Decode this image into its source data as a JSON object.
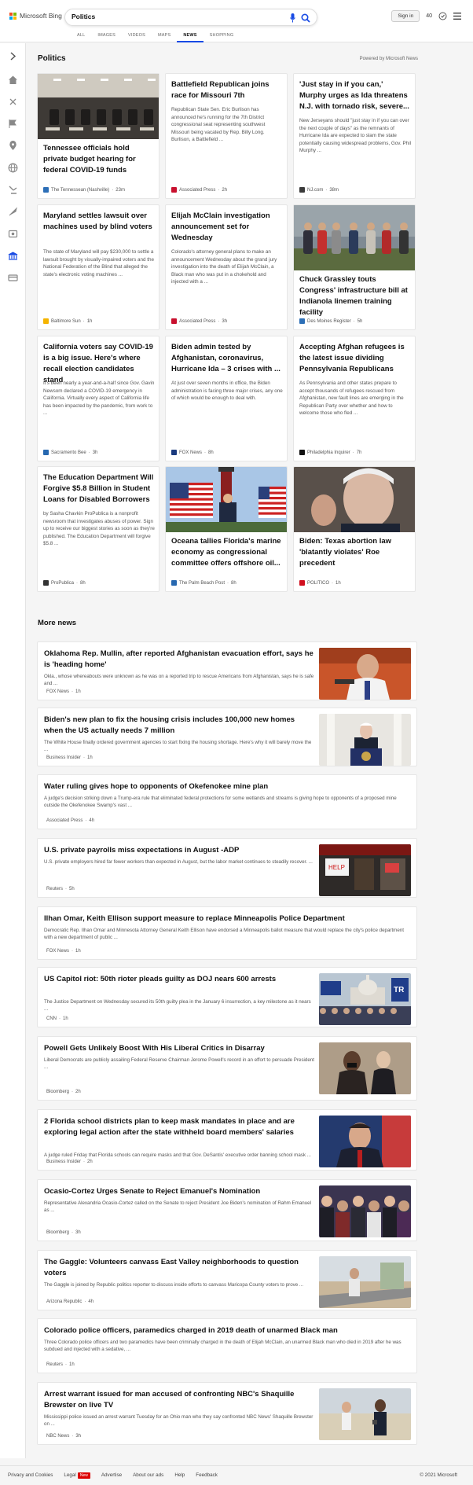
{
  "header": {
    "brand": "Microsoft Bing",
    "search_value": "Politics",
    "signin": "Sign in",
    "points": "40"
  },
  "nav": [
    "ALL",
    "IMAGES",
    "VIDEOS",
    "MAPS",
    "NEWS",
    "SHOPPING"
  ],
  "section_title": "Politics",
  "powered_by": "Powered by Microsoft News",
  "cards": [
    {
      "title": "Tennessee officials hold private budget hearing for federal COVID-19 funds",
      "snippet": "",
      "source": "The Tennessean (Nashville)",
      "age": "23m",
      "image": "meeting-room"
    },
    {
      "title": "Battlefield Republican joins race for Missouri 7th",
      "snippet": "Republican State Sen. Eric Burlison has announced he's running for the 7th District congressional seat representing southwest Missouri being vacated by Rep. Billy Long. Burlison, a Battlefield ...",
      "source": "Associated Press",
      "age": "2h",
      "image": ""
    },
    {
      "title": "'Just stay in if you can,' Murphy urges as Ida threatens N.J. with tornado risk, severe...",
      "snippet": "New Jerseyans should \"just stay in if you can over the next couple of days\" as the remnants of Hurricane Ida are expected to slam the state potentially causing widespread problems, Gov. Phil Murphy ...",
      "source": "NJ.com",
      "age": "38m",
      "image": ""
    },
    {
      "title": "Maryland settles lawsuit over machines used by blind voters",
      "snippet": "The state of Maryland will pay $230,000 to settle a lawsuit brought by visually-impaired voters and the National Federation of the Blind that alleged the state's electronic voting machines ...",
      "source": "Baltimore Sun",
      "age": "1h",
      "image": ""
    },
    {
      "title": "Elijah McClain investigation announcement set for Wednesday",
      "snippet": "Colorado's attorney general plans to make an announcement Wednesday about the grand jury investigation into the death of Elijah McClain, a Black man who was put in a chokehold and injected with a ...",
      "source": "Associated Press",
      "age": "3h",
      "image": ""
    },
    {
      "title": "Chuck Grassley touts Congress' infrastructure bill at Indianola linemen training facility",
      "snippet": "",
      "source": "Des Moines Register",
      "age": "5h",
      "image": "crowd-outdoors"
    },
    {
      "title": "California voters say COVID-19 is a big issue. Here's where recall election candidates stand",
      "snippet": "It's been nearly a year-and-a-half since Gov. Gavin Newsom declared a COVID-19 emergency in California. Virtually every aspect of California life has been impacted by the pandemic, from work to ...",
      "source": "Sacramento Bee",
      "age": "3h",
      "image": ""
    },
    {
      "title": "Biden admin tested by Afghanistan, coronavirus, Hurricane Ida – 3 crises with ...",
      "snippet": "At just over seven months in office, the Biden administration is facing three major crises, any one of which would be enough to deal with.",
      "source": "FOX News",
      "age": "8h",
      "image": ""
    },
    {
      "title": "Accepting Afghan refugees is the latest issue dividing Pennsylvania Republicans",
      "snippet": "As Pennsylvania and other states prepare to accept thousands of refugees rescued from Afghanistan, new fault lines are emerging in the Republican Party over whether and how to welcome those who fled ...",
      "source": "Philadelphia Inquirer",
      "age": "7h",
      "image": ""
    },
    {
      "title": "The Education Department Will Forgive $5.8 Billion in Student Loans for Disabled Borrowers",
      "snippet": "by Sasha Chavkin ProPublica is a nonprofit newsroom that investigates abuses of power. Sign up to receive our biggest stories as soon as they're published. The Education Department will forgive $5.8 ...",
      "source": "ProPublica",
      "age": "8h",
      "image": ""
    },
    {
      "title": "Oceana tallies Florida's marine economy as congressional committee offers offshore oil...",
      "snippet": "",
      "source": "The Palm Beach Post",
      "age": "8h",
      "image": "flags-lighthouse"
    },
    {
      "title": "Biden: Texas abortion law 'blatantly violates' Roe precedent",
      "snippet": "",
      "source": "POLITICO",
      "age": "1h",
      "image": "biden-closeup"
    }
  ],
  "more_news_title": "More news",
  "more_news": [
    {
      "title": "Oklahoma Rep. Mullin, after reported Afghanistan evacuation effort, says he is 'heading home'",
      "snippet": "Okla., whose whereabouts were unknown as he was on a reported trip to rescue Americans from Afghanistan, says he is safe and ...",
      "source": "FOX News",
      "age": "1h",
      "image": "mullin"
    },
    {
      "title": "Biden's new plan to fix the housing crisis includes 100,000 new homes when the US actually needs 7 million",
      "snippet": "The White House finally ordered government agencies to start fixing the housing shortage. Here's why it will barely move the ...",
      "source": "Business Insider",
      "age": "1h",
      "image": "biden-podium"
    },
    {
      "title": "Water ruling gives hope to opponents of Okefenokee mine plan",
      "snippet": "A judge's decision striking down a Trump-era rule that eliminated federal protections for some wetlands and streams is giving hope to opponents of a proposed mine outside the Okefenokee Swamp's vast ...",
      "source": "Associated Press",
      "age": "4h",
      "image": ""
    },
    {
      "title": "U.S. private payrolls miss expectations in August -ADP",
      "snippet": "U.S. private employers hired far fewer workers than expected in August, but the labor market continues to steadily recover. ...",
      "source": "Reuters",
      "age": "5h",
      "image": "storefront"
    },
    {
      "title": "Ilhan Omar, Keith Ellison support measure to replace Minneapolis Police Department",
      "snippet": "Democratic Rep. Ilhan Omar and Minnesota Attorney General Keith Ellison have endorsed a Minneapolis ballot measure that would replace the city's police department with a new department of public ...",
      "source": "FOX News",
      "age": "1h",
      "image": ""
    },
    {
      "title": "US Capitol riot: 50th rioter pleads guilty as DOJ nears 600 arrests",
      "snippet": "The Justice Department on Wednesday secured its 50th guilty plea in the January 6 insurrection, a key milestone as it nears ...",
      "source": "CNN",
      "age": "1h",
      "image": "capitol"
    },
    {
      "title": "Powell Gets Unlikely Boost With His Liberal Critics in Disarray",
      "snippet": "Liberal Democrats are publicly assailing Federal Reserve Chairman Jerome Powell's record in an effort to persuade President ...",
      "source": "Bloomberg",
      "age": "2h",
      "image": "powell"
    },
    {
      "title": "2 Florida school districts plan to keep mask mandates in place and are exploring legal action after the state withheld board members' salaries",
      "snippet": "A judge ruled Friday that Florida schools can require masks and that Gov. DeSantis' executive order banning school mask ...",
      "source": "Business Insider",
      "age": "2h",
      "image": "desantis"
    },
    {
      "title": "Ocasio-Cortez Urges Senate to Reject Emanuel's Nomination",
      "snippet": "Representative Alexandria Ocasio-Cortez called on the Senate to reject President Joe Biden's nomination of Rahm Emanuel as ...",
      "source": "Bloomberg",
      "age": "3h",
      "image": "aoc"
    },
    {
      "title": "The Gaggle: Volunteers canvass East Valley neighborhoods to question voters",
      "snippet": "The Gaggle is joined by Republic politics reporter to discuss inside efforts to canvass Maricopa County voters to prove ...",
      "source": "Arizona Republic",
      "age": "4h",
      "image": "street"
    },
    {
      "title": "Colorado police officers, paramedics charged in 2019 death of unarmed Black man",
      "snippet": "Three Colorado police officers and two paramedics have been criminally charged in the death of Elijah McClain, an unarmed Black man who died in 2019 after he was subdued and injected with a sedative, ...",
      "source": "Reuters",
      "age": "1h",
      "image": ""
    },
    {
      "title": "Arrest warrant issued for man accused of confronting NBC's Shaquille Brewster on live TV",
      "snippet": "Mississippi police issued an arrest warrant Tuesday for an Ohio man who they say confronted NBC News' Shaquille Brewster on ...",
      "source": "NBC News",
      "age": "3h",
      "image": "beach"
    }
  ],
  "footer": {
    "links": [
      "Privacy and Cookies",
      "Legal",
      "Advertise",
      "About our ads",
      "Help",
      "Feedback"
    ],
    "new_badge": "New",
    "copyright": "© 2021 Microsoft"
  }
}
